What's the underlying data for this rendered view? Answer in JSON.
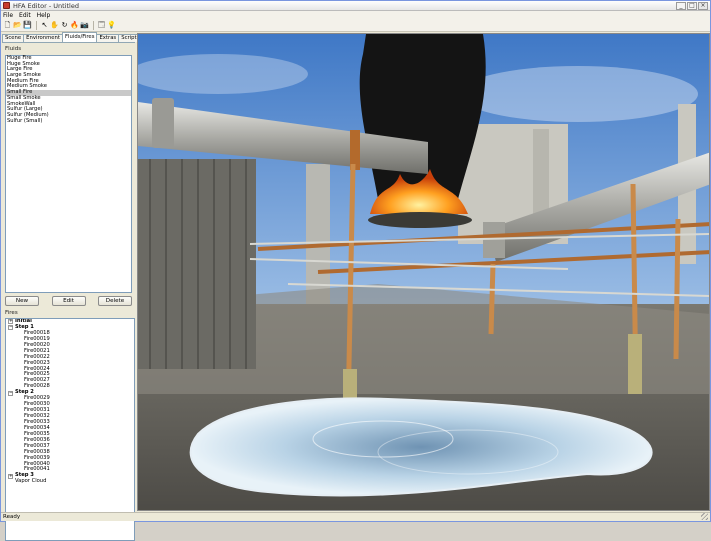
{
  "window": {
    "title": "HFA Editor - Untitled",
    "controls": [
      "_",
      "□",
      "×"
    ]
  },
  "menu": [
    "File",
    "Edit",
    "Help"
  ],
  "toolbar": {
    "icons": [
      "new-file-icon",
      "open-folder-icon",
      "save-icon",
      "|",
      "pointer-icon",
      "hand-icon",
      "rotate-icon",
      "fire-icon",
      "camera-icon",
      "|",
      "window-icon",
      "lightbulb-icon"
    ],
    "glyphs": [
      "🗋",
      "📂",
      "💾",
      "",
      "↖",
      "✋",
      "↻",
      "🔥",
      "📷",
      "",
      "🗔",
      "💡"
    ]
  },
  "tabs": {
    "items": [
      "Scene",
      "Environment",
      "Fluids/Fires",
      "Extras",
      "Scripts"
    ],
    "active": 2,
    "scroll_left": "◂",
    "scroll_right": "▸"
  },
  "fluids": {
    "label": "Fluids",
    "items": [
      "Huge Fire",
      "Huge Smoke",
      "Large Fire",
      "Large Smoke",
      "Medium Fire",
      "Medium Smoke",
      "Small Fire",
      "Small Smoke",
      "SmokeWall",
      "Sulfur (Large)",
      "Sulfur (Medium)",
      "Sulfur (Small)"
    ],
    "selected": 6
  },
  "buttons": {
    "new": "New",
    "edit": "Edit",
    "delete": "Delete"
  },
  "tree": {
    "label": "Fires",
    "rows": [
      {
        "text": "Initial",
        "level": 0,
        "bold": true,
        "exp": "+"
      },
      {
        "text": "Step 1",
        "level": 0,
        "bold": true,
        "exp": "−"
      },
      {
        "text": "Fire00018",
        "level": 1
      },
      {
        "text": "Fire00019",
        "level": 1
      },
      {
        "text": "Fire00020",
        "level": 1
      },
      {
        "text": "Fire00021",
        "level": 1
      },
      {
        "text": "Fire00022",
        "level": 1
      },
      {
        "text": "Fire00023",
        "level": 1
      },
      {
        "text": "Fire00024",
        "level": 1
      },
      {
        "text": "Fire00025",
        "level": 1
      },
      {
        "text": "Fire00027",
        "level": 1
      },
      {
        "text": "Fire00028",
        "level": 1
      },
      {
        "text": "Step 2",
        "level": 0,
        "bold": true,
        "exp": "−"
      },
      {
        "text": "Fire00029",
        "level": 1
      },
      {
        "text": "Fire00030",
        "level": 1
      },
      {
        "text": "Fire00031",
        "level": 1
      },
      {
        "text": "Fire00032",
        "level": 1
      },
      {
        "text": "Fire00033",
        "level": 1
      },
      {
        "text": "Fire00034",
        "level": 1
      },
      {
        "text": "Fire00035",
        "level": 1
      },
      {
        "text": "Fire00036",
        "level": 1
      },
      {
        "text": "Fire00037",
        "level": 1
      },
      {
        "text": "Fire00038",
        "level": 1
      },
      {
        "text": "Fire00039",
        "level": 1
      },
      {
        "text": "Fire00040",
        "level": 1
      },
      {
        "text": "Fire00041",
        "level": 1
      },
      {
        "text": "Step 3",
        "level": 0,
        "bold": true,
        "exp": "+"
      },
      {
        "text": "Vapor Cloud",
        "level": 0
      }
    ]
  },
  "status": {
    "text": "Ready"
  }
}
